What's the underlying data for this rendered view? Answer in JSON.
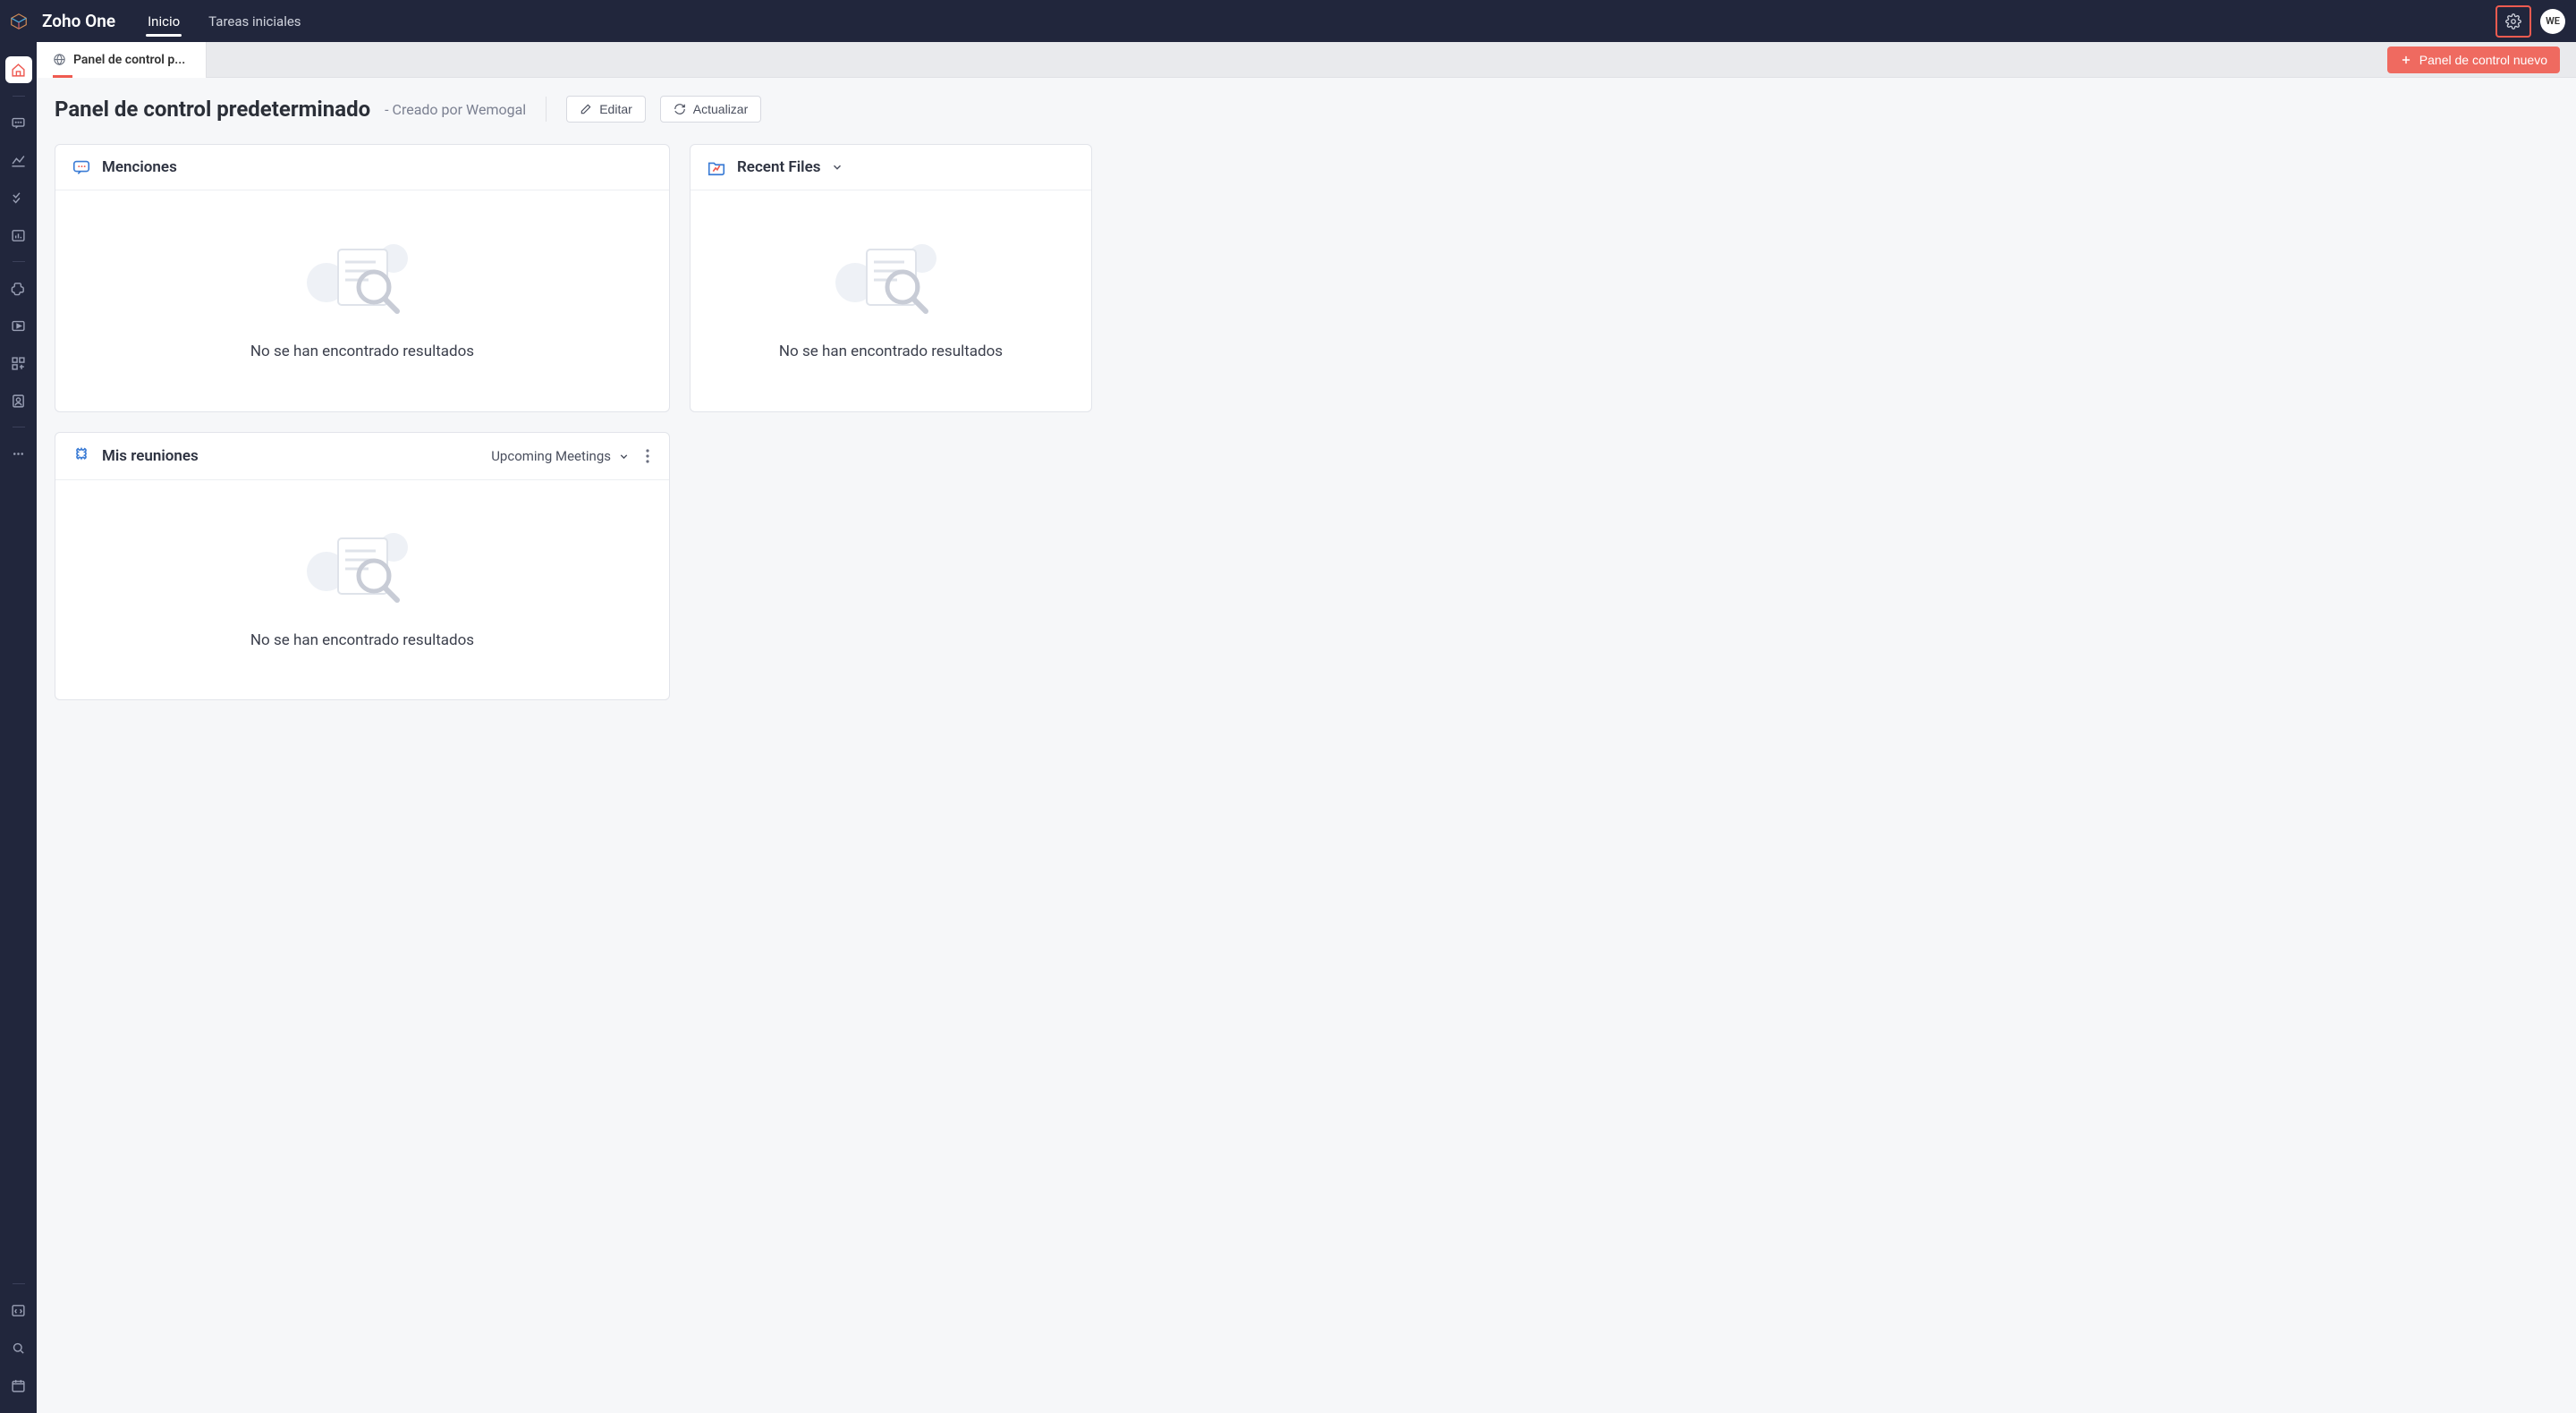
{
  "header": {
    "brand": "Zoho One",
    "tabs": [
      {
        "label": "Inicio",
        "active": true
      },
      {
        "label": "Tareas iniciales",
        "active": false
      }
    ],
    "avatar_initials": "WE"
  },
  "subheader": {
    "active_tab_label": "Panel de control p...",
    "new_dashboard_label": "Panel de control nuevo"
  },
  "titlebar": {
    "title": "Panel de control predeterminado",
    "byline": "- Creado por Wemogal",
    "edit_label": "Editar",
    "refresh_label": "Actualizar"
  },
  "widgets": {
    "mentions": {
      "title": "Menciones",
      "empty": "No se han encontrado resultados"
    },
    "recent_files": {
      "title": "Recent Files",
      "empty": "No se han encontrado resultados"
    },
    "my_meetings": {
      "title": "Mis reuniones",
      "filter_label": "Upcoming Meetings",
      "empty": "No se han encontrado resultados"
    }
  },
  "leftbar_icons": [
    "home",
    "chat",
    "analytics",
    "checklist",
    "reports",
    "puzzle",
    "play",
    "widget",
    "contact",
    "more",
    "code",
    "search",
    "calendar"
  ]
}
